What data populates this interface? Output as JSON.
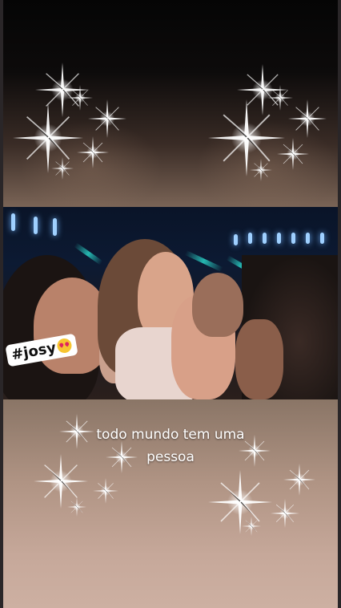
{
  "hashtag": {
    "text": "#josy",
    "emoji": "heart-eyes-emoji"
  },
  "caption": {
    "line1": "todo mundo tem uma",
    "line2": "pessoa"
  },
  "colors": {
    "sparkle": "#ffffff",
    "stage_light": "#9fd0ff",
    "beam": "#28c8be"
  }
}
